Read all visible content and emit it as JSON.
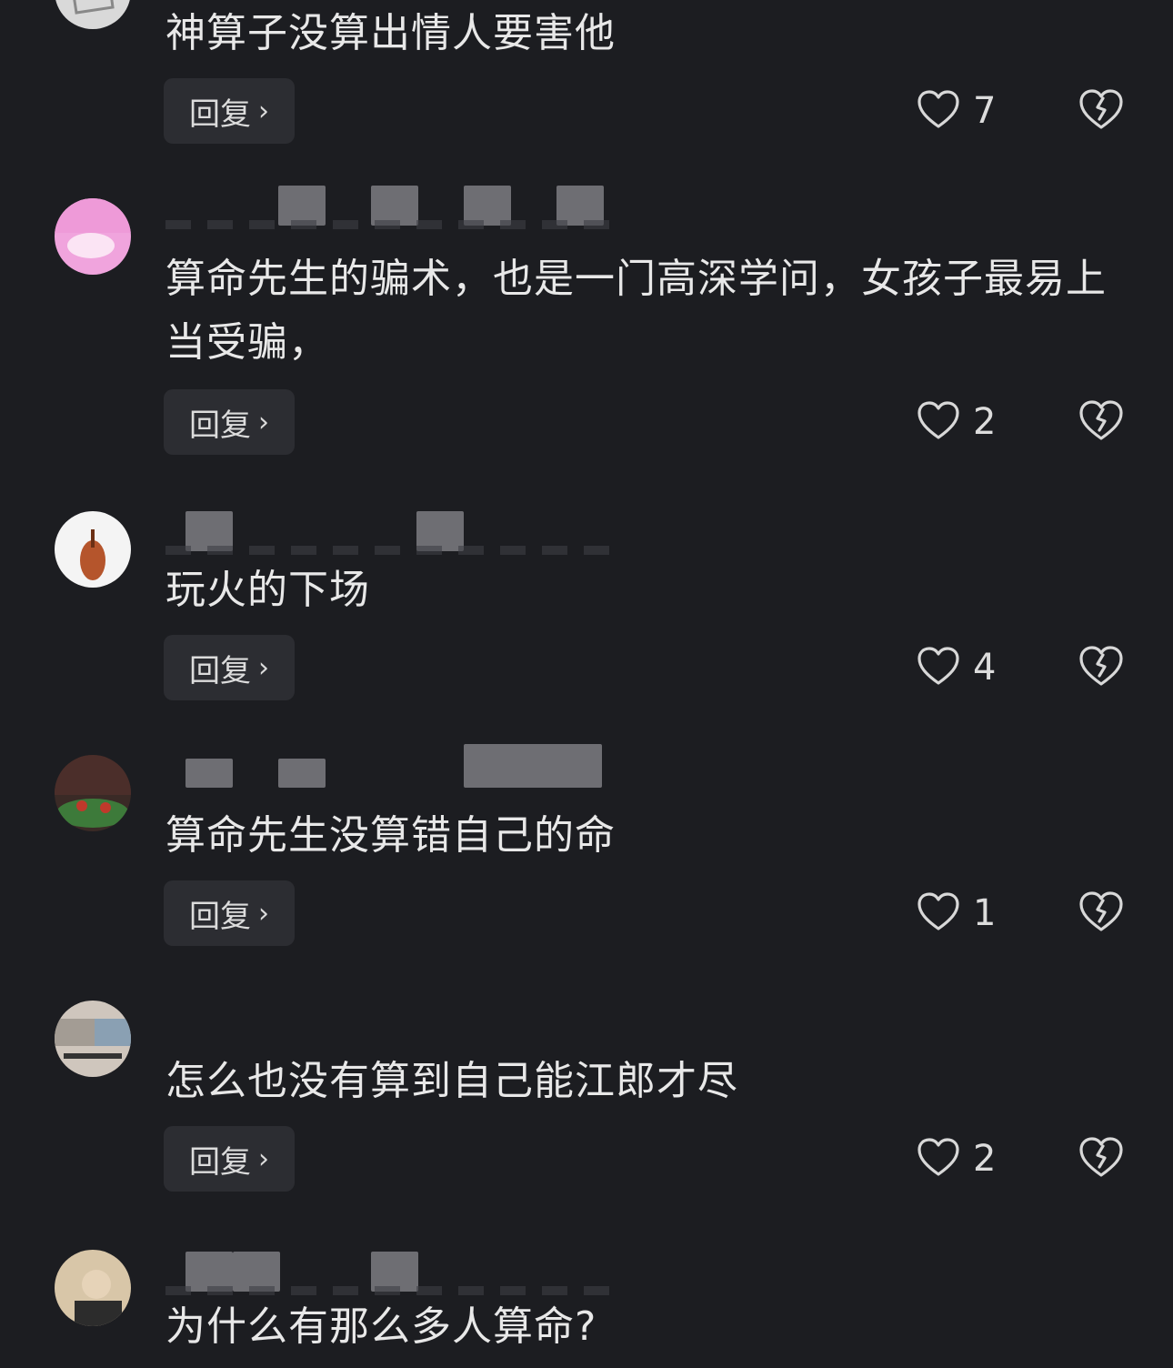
{
  "reply_label": "回复",
  "comments": [
    {
      "text": "神算子没算出情人要害他",
      "likes": "7"
    },
    {
      "text": "算命先生的骗术，也是一门高深学问，女孩子最易上当受骗，",
      "likes": "2"
    },
    {
      "text": "玩火的下场",
      "likes": "4"
    },
    {
      "text": "算命先生没算错自己的命",
      "likes": "1"
    },
    {
      "text": "怎么也没有算到自己能江郎才尽",
      "likes": "2"
    },
    {
      "text": "为什么有那么多人算命?"
    }
  ],
  "icons": {
    "like": "heart-outline-icon",
    "dislike": "broken-heart-icon",
    "reply_chevron": "chevron-right-icon"
  },
  "colors": {
    "background": "#1c1d21",
    "button_bg": "#2c2d32",
    "text": "#e8e8e8"
  }
}
